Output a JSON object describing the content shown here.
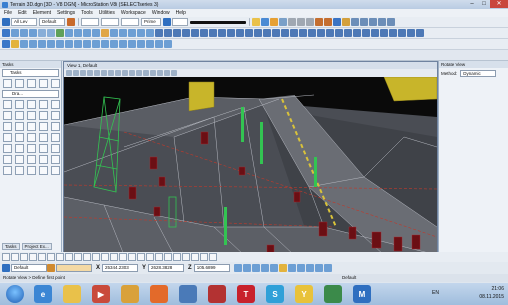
{
  "window": {
    "title": "Terrain 3D.dgn [3D - V8 DGN] - MicroStation V8i (SELECTseries 3)",
    "buttons": [
      "–",
      "□",
      "✕"
    ]
  },
  "menu": [
    "File",
    "Edit",
    "Element",
    "Settings",
    "Tools",
    "Utilities",
    "Workspace",
    "Window",
    "Help"
  ],
  "toolbar1": {
    "level": "All Lev",
    "style": "Default",
    "print": "Prime"
  },
  "tasks_panel": {
    "title": "Tasks",
    "dropdown": "Tasks",
    "section": "Dra...",
    "tabs": [
      "Tasks",
      "Project Ex..."
    ]
  },
  "view": {
    "title": "View 1, Default"
  },
  "right_panel": {
    "title": "Rotate View",
    "method_label": "Method:",
    "method_value": "Dynamic"
  },
  "accudraw": {
    "snap": "Default",
    "x_label": "X",
    "x": "25344.2303",
    "y_label": "Y",
    "y": "2628.3828",
    "z_label": "Z",
    "z": "105.6899"
  },
  "status": {
    "left": "Rotate View > Define first point",
    "right": "Default"
  },
  "taskbar": {
    "lang": "EN",
    "time": "21:06",
    "date": "08.11.2015"
  },
  "colors": {
    "terrain": "#4a4d54",
    "mesh": "#a8aab2",
    "poles": "#33c452",
    "pillars": "#6b0f14",
    "buildings": "#c8b52a",
    "sky": "#0a0a0a"
  }
}
